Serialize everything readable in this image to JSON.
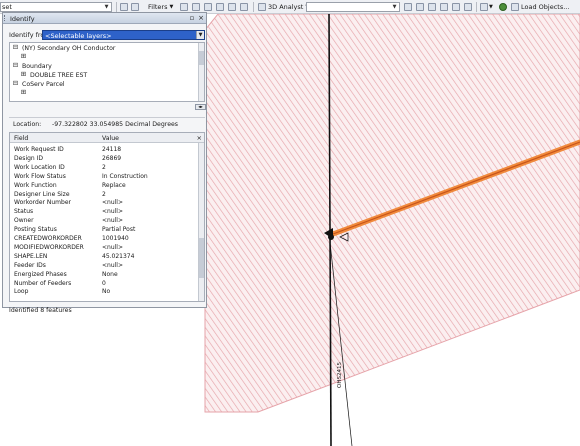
{
  "toolbar": {
    "left_fragment": "set",
    "filters_label": "Filters",
    "analyst_label": "3D Analyst",
    "load_objects_label": "Load Objects..."
  },
  "identify": {
    "title": "Identify",
    "identify_from_label": "Identify from:",
    "identify_from_value": "<Selectable layers>",
    "tree": [
      {
        "label": "(NY) Secondary OH Conductor",
        "expander": "⊟",
        "indent": 0
      },
      {
        "label": "",
        "expander": "⊞",
        "indent": 1
      },
      {
        "label": "Boundary",
        "expander": "⊟",
        "indent": 0
      },
      {
        "label": "DOUBLE TREE EST",
        "expander": "⊞",
        "indent": 1
      },
      {
        "label": "CoServ Parcel",
        "expander": "⊟",
        "indent": 0
      },
      {
        "label": "",
        "expander": "⊞",
        "indent": 1
      }
    ],
    "location_label": "Location:",
    "location_value": "-97.322802  33.054985 Decimal Degrees",
    "field_header": "Field",
    "value_header": "Value",
    "rows": [
      {
        "field": "Work Request ID",
        "value": "24118"
      },
      {
        "field": "Design ID",
        "value": "26869"
      },
      {
        "field": "Work Location ID",
        "value": "2"
      },
      {
        "field": "Work Flow Status",
        "value": "In Construction"
      },
      {
        "field": "Work Function",
        "value": "Replace"
      },
      {
        "field": "Designer Line Size",
        "value": "2"
      },
      {
        "field": "Workorder Number",
        "value": "<null>"
      },
      {
        "field": "Status",
        "value": "<null>"
      },
      {
        "field": "Owner",
        "value": "<null>"
      },
      {
        "field": "Posting Status",
        "value": "Partial Post"
      },
      {
        "field": "CREATEDWORKORDER",
        "value": "1001940"
      },
      {
        "field": "MODIFIEDWORKORDER",
        "value": "<null>"
      },
      {
        "field": "SHAPE.LEN",
        "value": "45.021374"
      },
      {
        "field": "Feeder IDs",
        "value": "<null>"
      },
      {
        "field": "Energized Phases",
        "value": "None"
      },
      {
        "field": "Number of Feeders",
        "value": "0"
      },
      {
        "field": "Loop",
        "value": "No"
      }
    ],
    "status_text": "Identified 8 features"
  },
  "map": {
    "label": "OHS2415",
    "hatch_color": "#e6a3a9",
    "highlight_color": "#f08a3c"
  }
}
